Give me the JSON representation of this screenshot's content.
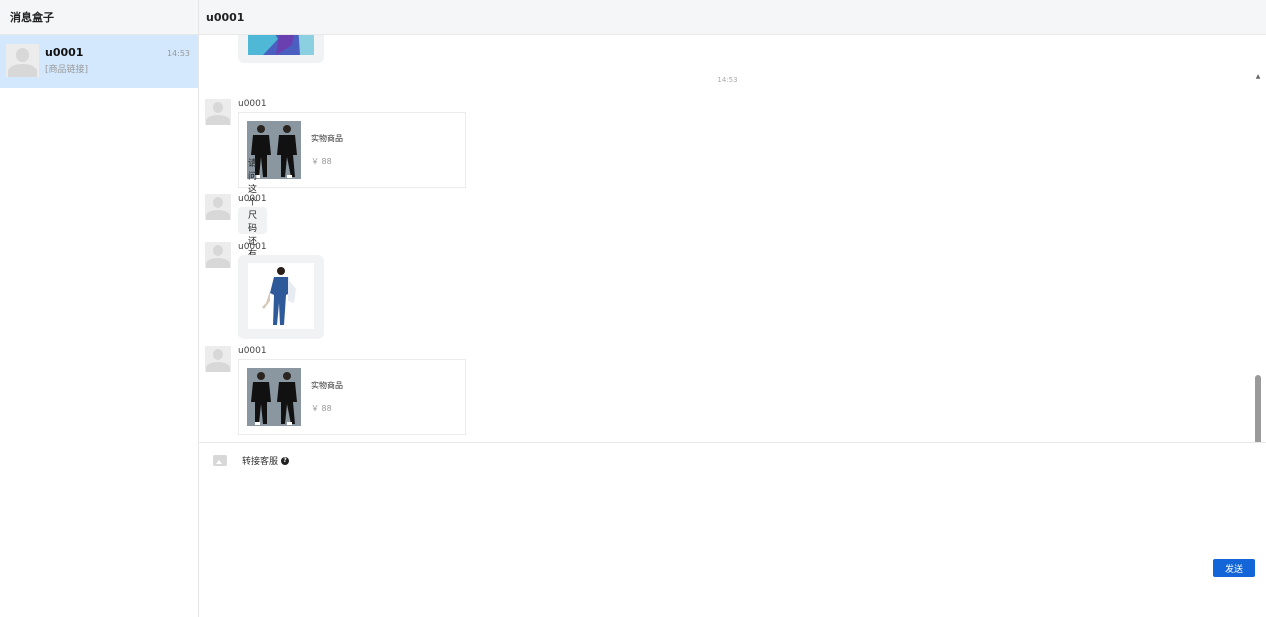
{
  "sidebar": {
    "title": "消息盒子",
    "conversations": [
      {
        "name": "u0001",
        "preview": "[商品链接]",
        "time": "14:53",
        "selected": true
      }
    ]
  },
  "chat": {
    "title": "u0001",
    "time_divider": "14:53",
    "messages": [
      {
        "sender": "u0001",
        "type": "product",
        "product_name": "实物商品",
        "price": "￥ 88"
      },
      {
        "sender": "u0001",
        "type": "text",
        "text": "请问这个尺码还有货吗"
      },
      {
        "sender": "u0001",
        "type": "image"
      },
      {
        "sender": "u0001",
        "type": "product",
        "product_name": "实物商品",
        "price": "￥ 88"
      }
    ]
  },
  "composer": {
    "image_icon": "image-icon",
    "transfer_label": "转接客服",
    "help_icon": "question-circle-icon",
    "send_label": "发送"
  },
  "colors": {
    "selected_conversation": "#d4e8fd",
    "send_button": "#1466d8",
    "header_bg": "#f5f6f8"
  }
}
